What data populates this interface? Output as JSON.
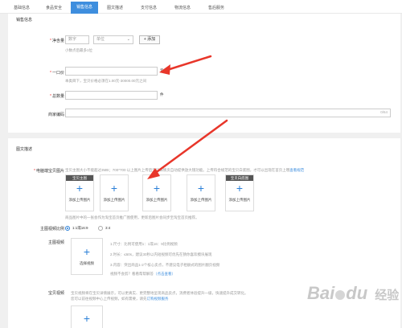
{
  "tabs": [
    {
      "label": "基础信息",
      "active": false
    },
    {
      "label": "食品安全",
      "active": false
    },
    {
      "label": "销售信息",
      "active": true
    },
    {
      "label": "图文描述",
      "active": false
    },
    {
      "label": "支付信息",
      "active": false
    },
    {
      "label": "物流信息",
      "active": false
    },
    {
      "label": "售后服务",
      "active": false
    }
  ],
  "sales": {
    "section_title": "销售信息",
    "net_content": {
      "label": "净含量",
      "number_placeholder": "数字",
      "unit_placeholder": "单位",
      "add_label": "+ 添加",
      "hint": "小数点后最多1位"
    },
    "price": {
      "label": "一口价",
      "suffix": "元",
      "hint": "本类目下，宝贝价格必须在1.00元-30000.00元之间"
    },
    "quantity": {
      "label": "总数量",
      "suffix": "件"
    },
    "merchant_code": {
      "label": "商家编码",
      "counter": "0/64"
    }
  },
  "description": {
    "section_title": "图文描述",
    "main_images": {
      "label": "电脑端宝贝图片",
      "hint_top": "宝贝主图大小不能超过3MB；700*700 以上图片上传后宝贝详情页自动提供放大镜功能。上传符合规范的宝贝白底图，才可以出现在首页上哦",
      "hint_top_link": "查看规范",
      "slots": [
        {
          "head": "宝贝主图",
          "caption": "添加上传图片"
        },
        {
          "head": "",
          "caption": "添加上传图片"
        },
        {
          "head": "",
          "caption": "添加上传图片"
        },
        {
          "head": "",
          "caption": "添加上传图片"
        },
        {
          "head": "宝贝白底图",
          "caption": "添加上传图片"
        }
      ],
      "hint_bottom": "商品图片中的一张会作为淘宝首页推广图使用，更新后图片会同步至淘宝首页推荐。"
    },
    "video_ratio": {
      "label": "主图视频比例",
      "options": [
        "1:1或16:9",
        "3:4"
      ],
      "selected": 0
    },
    "main_video": {
      "label": "主图视频",
      "upload_caption": "选择视频",
      "rules": [
        "1.尺寸：比例可使用1：1或16：9比例视频",
        "2.时长：≤60s，建议30秒以内短视频可优先在猜你喜欢模块展现",
        "3.内容：突出商品1-2个核心卖点，不建议电子相册式的图片翻页视频"
      ],
      "rules_footer": "视频不会剪？看看帮帮解答",
      "rules_footer_link": "（点击查看）"
    },
    "baby_video": {
      "label": "宝贝视频",
      "hint_line1": "宝贝视频将在宝贝详情展示，可以更真实、更完整地呈现商品卖点，消费者体验提升一级，快速提升成交转化。",
      "hint_line2": "您可以前往视频中心上传视频，如有需要，请先",
      "hint_line2_link": "订购视频服务"
    }
  },
  "watermark": {
    "logo_text": "Bai",
    "brand_text": "经验",
    "logo_suffix": "du"
  },
  "colors": {
    "accent": "#3e8ede",
    "arrow": "#e8362a",
    "required": "#e33333"
  }
}
